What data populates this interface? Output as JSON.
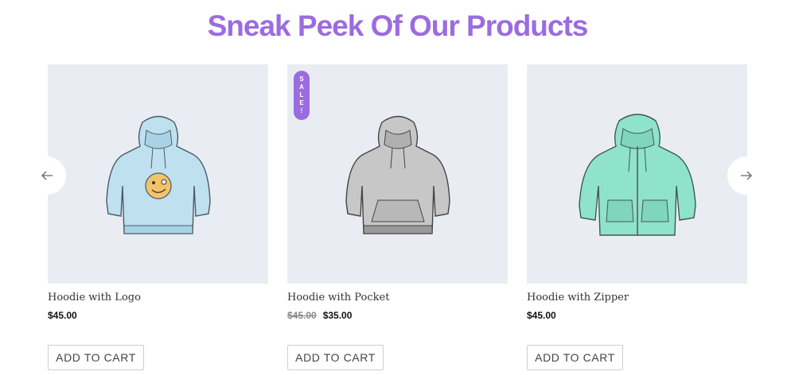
{
  "section": {
    "title": "Sneak Peek Of Our Products"
  },
  "products": [
    {
      "name": "Hoodie with Logo",
      "price": "$45.00",
      "cta": "ADD TO CART",
      "image": "hoodie-logo-image",
      "color": "#bfe0ef"
    },
    {
      "name": "Hoodie with Pocket",
      "old_price": "$45.00",
      "price": "$35.00",
      "cta": "ADD TO CART",
      "badge": [
        "S",
        "A",
        "L",
        "E",
        "!"
      ],
      "image": "hoodie-pocket-image",
      "color": "#bdbdbd"
    },
    {
      "name": "Hoodie with Zipper",
      "price": "$45.00",
      "cta": "ADD TO CART",
      "image": "hoodie-zipper-image",
      "color": "#8fe3cb"
    }
  ],
  "carousel": {
    "prev": "arrow-left-icon",
    "next": "arrow-right-icon"
  },
  "colors": {
    "accent": "#9b6ce0",
    "image_bg": "#e9edf3"
  }
}
